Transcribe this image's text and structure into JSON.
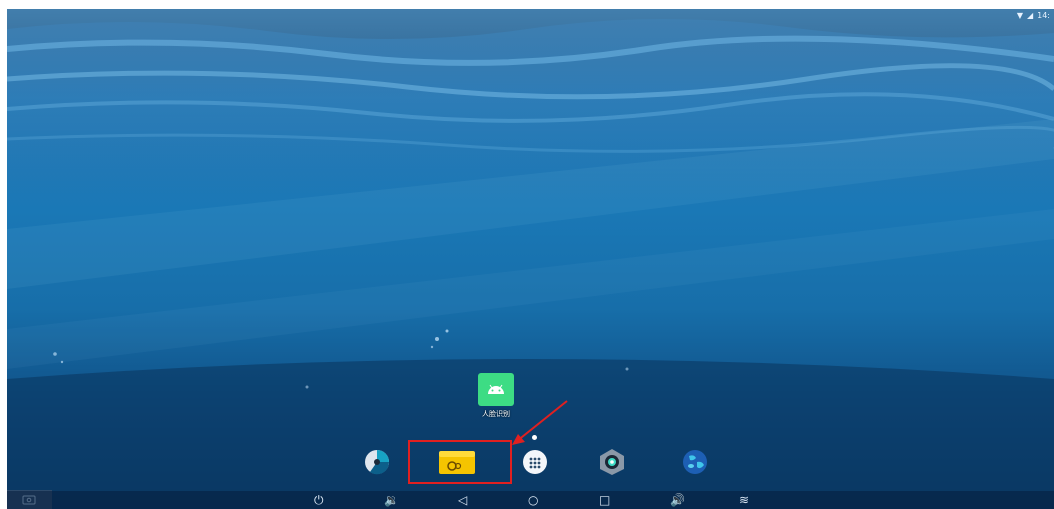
{
  "status_bar": {
    "wifi_icon": "wifi-icon",
    "signal_icon": "signal-icon",
    "time": "14:"
  },
  "home": {
    "app_shortcut": {
      "label": "人脸识别",
      "icon": "android-robot-icon",
      "color": "#3ddc84"
    }
  },
  "dock": [
    {
      "name": "dock-file-manager",
      "icon": "file-manager-icon"
    },
    {
      "name": "dock-settings-folder",
      "icon": "gear-folder-icon",
      "color": "#f5c400"
    },
    {
      "name": "dock-app-drawer",
      "icon": "app-drawer-icon"
    },
    {
      "name": "dock-camera",
      "icon": "camera-icon"
    },
    {
      "name": "dock-browser",
      "icon": "globe-icon"
    }
  ],
  "nav_bar": {
    "power": "⏻",
    "volume_down": "🔉",
    "back": "◁",
    "home": "○",
    "recents": "□",
    "volume_up": "🔊",
    "expand": "≋"
  },
  "annotation": {
    "highlight_color": "#e02020"
  }
}
